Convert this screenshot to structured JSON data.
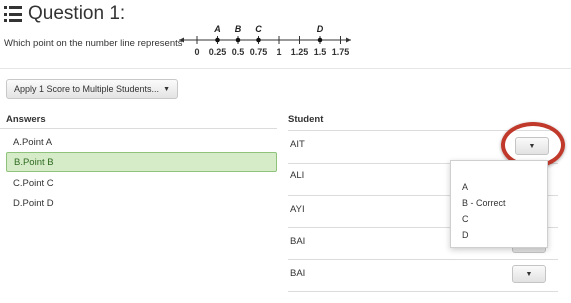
{
  "question": {
    "title": "Question 1:",
    "prompt": "Which point on the number line represents"
  },
  "number_line": {
    "ticks": [
      "0",
      "0.25",
      "0.5",
      "0.75",
      "1",
      "1.25",
      "1.5",
      "1.75"
    ],
    "points": [
      {
        "label": "A",
        "value": 0.25
      },
      {
        "label": "B",
        "value": 0.5
      },
      {
        "label": "C",
        "value": 0.75
      },
      {
        "label": "D",
        "value": 1.5
      }
    ]
  },
  "toolbar": {
    "apply_label": "Apply 1 Score to Multiple Students..."
  },
  "answers": {
    "header": "Answers",
    "items": [
      "A.Point A",
      "B.Point B",
      "C.Point C",
      "D.Point D"
    ],
    "selected_index": 1
  },
  "students": {
    "header": "Student",
    "names": [
      "AIT",
      "ALI",
      "AYI",
      "BAI",
      "BAI"
    ]
  },
  "score_dropdown": {
    "options": [
      "A",
      "B - Correct",
      "C",
      "D"
    ]
  },
  "colors": {
    "selected_bg": "#d6ecc9",
    "selected_border": "#8fc27a",
    "highlight": "#c0392b"
  }
}
